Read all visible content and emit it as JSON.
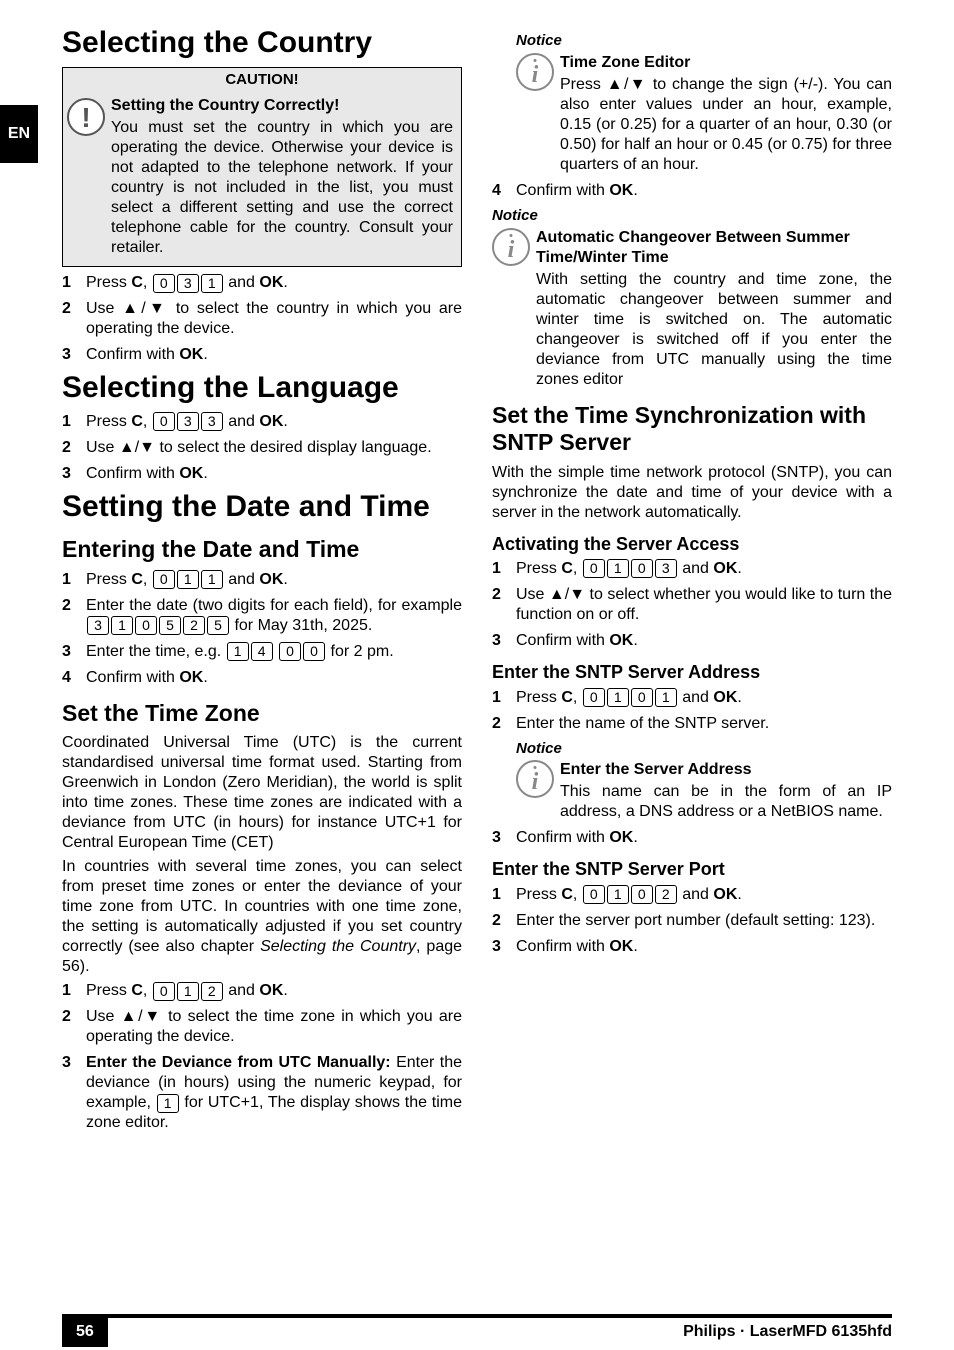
{
  "lang": "EN",
  "s1": {
    "h1": "Selecting the Country",
    "caution_title": "CAUTION!",
    "caution_sub": "Setting the Country Correctly!",
    "caution_body": "You must set the country in which you are operating the device. Otherwise your device is not adapted to the telephone network. If your country is not included in the list, you must select a different setting and use the correct telephone cable for the country. Consult your retailer.",
    "step1_a": "Press ",
    "step1_b": ", ",
    "step1_c": " and ",
    "step1_d": ".",
    "step2": "Use ▲/▼ to select the country in which you are operating the device.",
    "step3_a": "Confirm with ",
    "step3_b": "."
  },
  "s2": {
    "h1": "Selecting the Language",
    "step1_a": "Press ",
    "step1_b": ", ",
    "step1_c": " and ",
    "step1_d": ".",
    "step2": "Use ▲/▼ to select the desired display language.",
    "step3_a": "Confirm with ",
    "step3_b": "."
  },
  "s3": {
    "h1": "Setting the Date and Time",
    "h2a": "Entering the Date and Time",
    "a1_a": "Press ",
    "a1_b": ", ",
    "a1_c": " and ",
    "a1_d": ".",
    "a2_a": "Enter the date (two digits for each field), for example ",
    "a2_b": " for May 31th, 2025.",
    "a3_a": "Enter the time, e.g. ",
    "a3_b": " for 2 pm.",
    "a4_a": "Confirm with ",
    "a4_b": ".",
    "h2b": "Set the Time Zone",
    "tz_p1": "Coordinated Universal Time (UTC) is the current standardised universal time format used.  Starting from Greenwich in London (Zero Meridian), the world is split into time zones. These time zones are indicated with a deviance from UTC (in hours) for instance UTC+1 for Central European Time (CET)",
    "tz_p2_a": "In countries with several time zones, you can select from preset time zones or enter the deviance of your time zone from UTC. In countries with one time zone, the setting is automatically adjusted if you set country correctly (see also chapter ",
    "tz_p2_b": "Selecting the Country",
    "tz_p2_c": ", page 56).",
    "b1_a": "Press ",
    "b1_b": ", ",
    "b1_c": " and ",
    "b1_d": ".",
    "b2": "Use ▲/▼ to select the time zone in which you are operating the device.",
    "b3_bold": "Enter the Deviance from UTC Manually:",
    "b3_a": " Enter the deviance (in hours) using the numeric keypad, for example, ",
    "b3_b": " for UTC+1, The display shows the time zone editor.",
    "notice1_label": "Notice",
    "notice1_title": "Time Zone Editor",
    "notice1_body": "Press ▲/▼ to change the sign (+/-). You can also enter values under an hour, example, 0.15 (or 0.25) for a quarter of an hour, 0.30 (or 0.50) for half an hour or 0.45 (or 0.75) for three quarters of an hour.",
    "b4_a": "Confirm with ",
    "b4_b": ".",
    "notice2_label": "Notice",
    "notice2_title": "Automatic Changeover Between Summer Time/Winter Time",
    "notice2_body": "With setting the country and time zone, the automatic changeover between summer and winter time is switched on. The automatic changeover is switched off if you enter the deviance from UTC manually using the time zones editor",
    "h2c": "Set the Time Synchronization with SNTP Server",
    "sntp_p": "With the simple time network protocol (SNTP), you can synchronize the date and time of your device with a server in the network automatically.",
    "h3a": "Activating the Server Access",
    "c1_a": "Press ",
    "c1_b": ", ",
    "c1_c": " and ",
    "c1_d": ".",
    "c2": "Use ▲/▼ to select whether you would like to turn the function on or off.",
    "c3_a": "Confirm with ",
    "c3_b": ".",
    "h3b": "Enter the SNTP Server Address",
    "d1_a": "Press ",
    "d1_b": ", ",
    "d1_c": " and ",
    "d1_d": ".",
    "d2": "Enter the name of the SNTP server.",
    "notice3_label": "Notice",
    "notice3_title": "Enter the Server Address",
    "notice3_body": "This name can be in the form of an IP address, a DNS address or a NetBIOS name.",
    "d3_a": "Confirm with ",
    "d3_b": ".",
    "h3c": "Enter the SNTP Server Port",
    "e1_a": "Press ",
    "e1_b": ", ",
    "e1_c": " and ",
    "e1_d": ".",
    "e2": "Enter the server port number (default setting: 123).",
    "e3_a": "Confirm with ",
    "e3_b": "."
  },
  "keys": {
    "C": "C",
    "OK": "OK",
    "k0": "0",
    "k1": "1",
    "k2": "2",
    "k3": "3",
    "k4": "4",
    "k5": "5"
  },
  "footer": {
    "page": "56",
    "product": "Philips · LaserMFD 6135hfd"
  }
}
